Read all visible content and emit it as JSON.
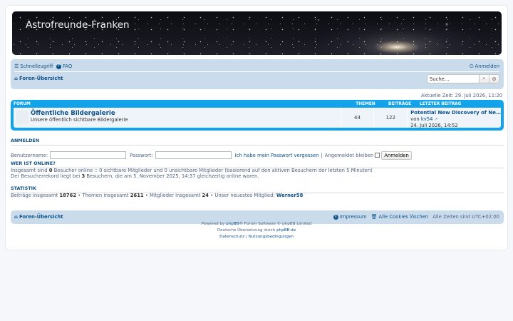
{
  "header": {
    "site_title": "Astrofreunde-Franken"
  },
  "navbar": {
    "quick_links": "Schnellzugriff",
    "faq": "FAQ",
    "login": "Anmelden",
    "breadcrumb": "Foren-Übersicht",
    "search_placeholder": "Suche…"
  },
  "current_time": "Aktuelle Zeit: 29. Juli 2026, 11:20",
  "forum_table": {
    "headers": {
      "forum": "Forum",
      "topics": "Themen",
      "posts": "Beiträge",
      "last_post": "Letzter Beitrag"
    },
    "rows": [
      {
        "name": "Öffentliche Bildergalerie",
        "description": "Unsere öffentlich sichtbare Bildergalerie",
        "topics": "44",
        "posts": "122",
        "last_title": "Potential New Discovery of Ne…",
        "last_by_prefix": "von",
        "last_by_user": "kv54",
        "last_date": "24. Juli 2026, 14:52"
      }
    ]
  },
  "login_section": {
    "title": "Anmelden",
    "username_label": "Benutzername:",
    "password_label": "Passwort:",
    "forgot_password": "Ich habe mein Passwort vergessen",
    "separator": "|",
    "remember_me": "Angemeldet bleiben",
    "login_button": "Anmelden"
  },
  "online_section": {
    "title": "Wer ist online?",
    "line1_a": "Insgesamt sind",
    "line1_count": "0",
    "line1_b": "Besucher online :: 0 sichtbare Mitglieder und 0 unsichtbare Mitglieder (basierend auf den aktiven Besuchern der letzten 5 Minuten)",
    "line2_a": "Der Besucherrekord liegt bei",
    "line2_count": "3",
    "line2_b": "Besuchern, die am 5. November 2025, 14:37 gleichzeitig online waren."
  },
  "stats_section": {
    "title": "Statistik",
    "posts_label": "Beiträge insgesamt",
    "posts": "18762",
    "topics_label": "• Themen insgesamt",
    "topics": "2611",
    "members_label": "• Mitglieder insgesamt",
    "members": "24",
    "newest_label": "• Unser neuestes Mitglied:",
    "newest": "Werner58"
  },
  "footer_nav": {
    "breadcrumb": "Foren-Übersicht",
    "imprint": "Impressum",
    "delete_cookies": "Alle Cookies löschen",
    "timezone": "Alle Zeiten sind UTC+02:00"
  },
  "credits": {
    "powered_prefix": "Powered by",
    "phpbb": "phpBB",
    "powered_suffix": "® Forum Software © phpBB Limited",
    "translation_prefix": "Deutsche Übersetzung durch",
    "translation_link": "phpBB.de",
    "privacy": "Datenschutz",
    "sep": "|",
    "terms": "Nutzungsbedingungen"
  },
  "icons": [
    "bars-icon",
    "question-circle-icon",
    "power-icon",
    "home-icon",
    "search-icon",
    "cog-icon",
    "info-circle-icon",
    "trash-icon",
    "external-link-icon"
  ],
  "colors": {
    "accent": "#12a3eb",
    "link": "#105289",
    "navbar": "#cadceb"
  }
}
